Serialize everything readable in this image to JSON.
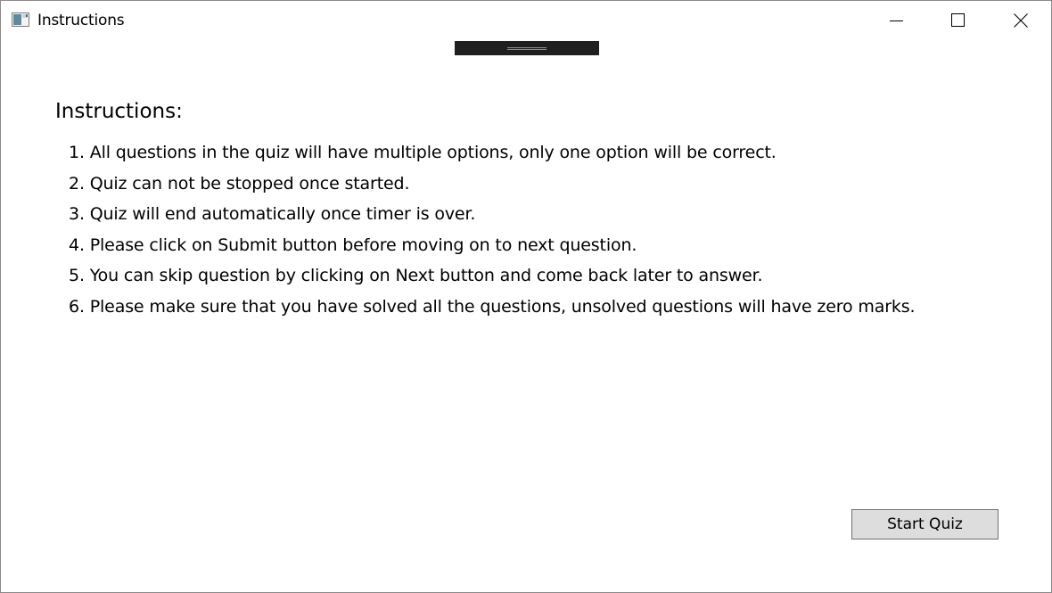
{
  "window": {
    "title": "Instructions",
    "icons": {
      "app": "app-window-icon",
      "minimize": "minimize-icon",
      "maximize": "maximize-icon",
      "close": "close-icon"
    }
  },
  "main": {
    "heading": "Instructions:",
    "items": [
      {
        "num": "1.",
        "text": "All questions in the quiz will have multiple options, only one option will be correct."
      },
      {
        "num": "2.",
        "text": "Quiz can not be stopped once started."
      },
      {
        "num": "3.",
        "text": "Quiz will end automatically once timer is over."
      },
      {
        "num": "4.",
        "text": "Please click on Submit button before moving on to next question."
      },
      {
        "num": "5.",
        "text": "You can skip question by clicking on Next button and come back later to answer."
      },
      {
        "num": "6.",
        "text": "Please make sure that you have solved all the questions, unsolved questions will have zero marks."
      }
    ],
    "start_button_label": "Start Quiz"
  },
  "colors": {
    "button_bg": "#dddddd",
    "button_border": "#707070",
    "debug_toolbar": "#1f1f1f"
  }
}
